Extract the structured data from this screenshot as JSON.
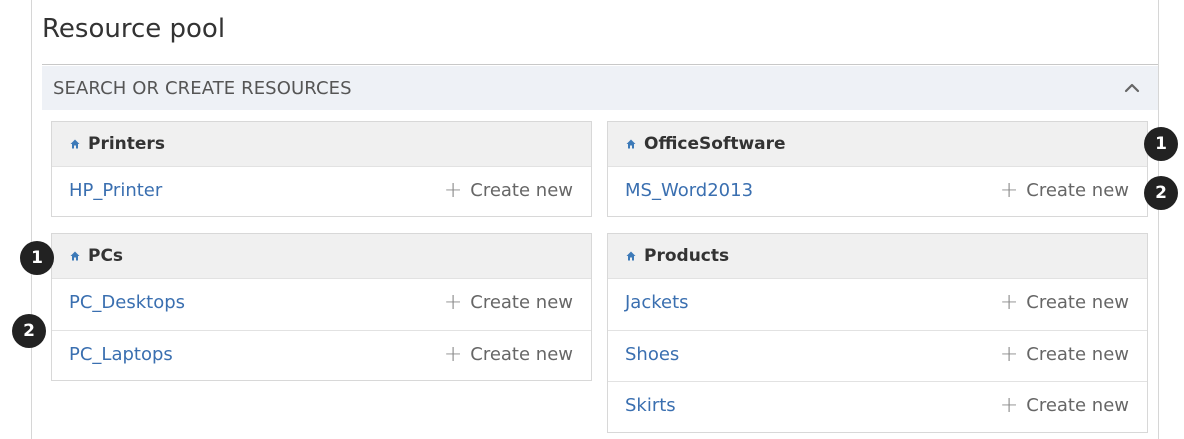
{
  "page": {
    "title": "Resource pool"
  },
  "section": {
    "label": "SEARCH OR CREATE RESOURCES",
    "collapse_icon": "chevron-up-icon"
  },
  "create_label": "Create new",
  "cards": [
    {
      "title": "Printers",
      "icon": "home-icon",
      "items": [
        "HP_Printer"
      ]
    },
    {
      "title": "OfficeSoftware",
      "icon": "home-icon",
      "items": [
        "MS_Word2013"
      ]
    },
    {
      "title": "PCs",
      "icon": "home-icon",
      "items": [
        "PC_Desktops",
        "PC_Laptops"
      ]
    },
    {
      "title": "Products",
      "icon": "home-icon",
      "items": [
        "Jackets",
        "Shoes",
        "Skirts"
      ]
    }
  ],
  "callouts": [
    "1",
    "2",
    "1",
    "2"
  ],
  "colors": {
    "link": "#3a6fb0",
    "icon_blue": "#3d7ab8",
    "header_bg": "#eef1f6",
    "badge": "#222222"
  }
}
